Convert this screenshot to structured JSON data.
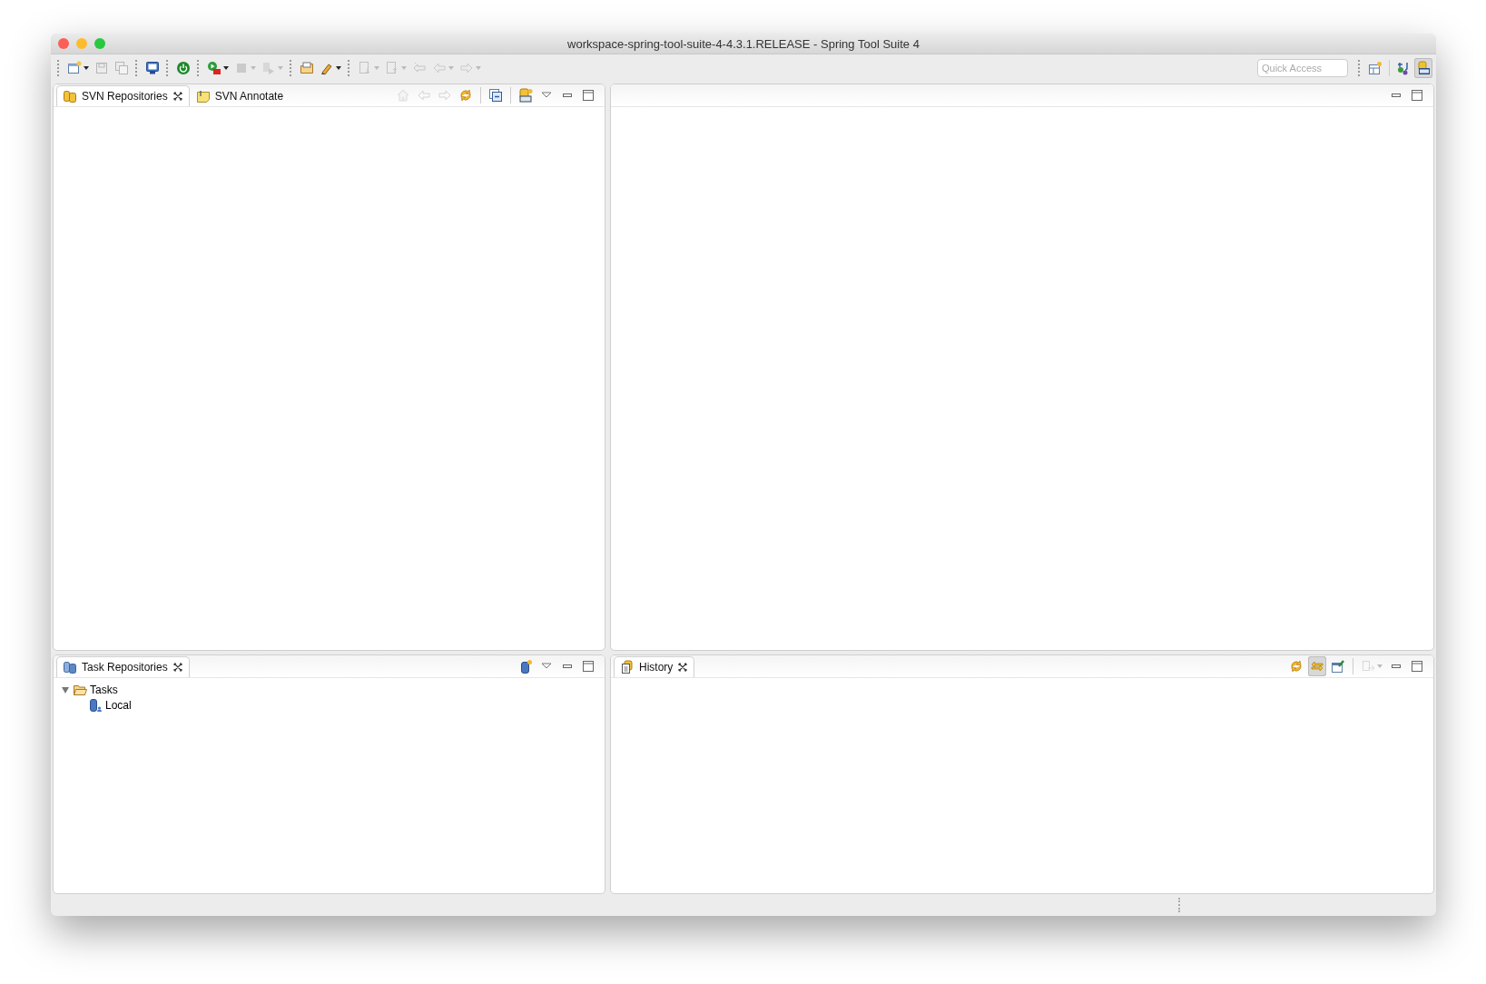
{
  "window": {
    "title": "workspace-spring-tool-suite-4-4.3.1.RELEASE - Spring Tool Suite 4"
  },
  "toolbar": [
    {
      "kind": "new",
      "disabled": false,
      "dropdown": true
    },
    {
      "kind": "save",
      "disabled": true,
      "dropdown": false
    },
    {
      "kind": "save-all",
      "disabled": true,
      "dropdown": false
    },
    {
      "kind": "sep"
    },
    {
      "kind": "console",
      "disabled": false,
      "dropdown": false
    },
    {
      "kind": "sep"
    },
    {
      "kind": "power",
      "disabled": false,
      "dropdown": false
    },
    {
      "kind": "sep"
    },
    {
      "kind": "run",
      "disabled": false,
      "dropdown": true
    },
    {
      "kind": "stop",
      "disabled": true,
      "dropdown": true
    },
    {
      "kind": "step",
      "disabled": true,
      "dropdown": true
    },
    {
      "kind": "sep"
    },
    {
      "kind": "open",
      "disabled": false,
      "dropdown": false
    },
    {
      "kind": "brush",
      "disabled": false,
      "dropdown": true
    },
    {
      "kind": "sep"
    },
    {
      "kind": "next",
      "disabled": true,
      "dropdown": true
    },
    {
      "kind": "prev",
      "disabled": true,
      "dropdown": true
    },
    {
      "kind": "last-edit",
      "disabled": true,
      "dropdown": false
    },
    {
      "kind": "back",
      "disabled": true,
      "dropdown": true
    },
    {
      "kind": "forward",
      "disabled": true,
      "dropdown": true
    }
  ],
  "quick_access": {
    "placeholder": "Quick Access"
  },
  "perspectives": [
    {
      "kind": "open-perspective",
      "selected": false
    },
    {
      "kind": "java",
      "selected": false
    },
    {
      "kind": "svn",
      "selected": true
    }
  ],
  "panels": [
    {
      "tabs": [
        {
          "label": "SVN Repositories",
          "kind": "repo",
          "selected": true,
          "closable": true
        },
        {
          "label": "SVN Annotate",
          "kind": "annotate",
          "selected": false,
          "closable": false
        }
      ],
      "actions": [
        {
          "kind": "home",
          "disabled": true
        },
        {
          "kind": "back",
          "disabled": true
        },
        {
          "kind": "forward",
          "disabled": true
        },
        {
          "kind": "sync",
          "disabled": false
        },
        {
          "kind": "sep"
        },
        {
          "kind": "collapse",
          "disabled": false
        },
        {
          "kind": "sep"
        },
        {
          "kind": "new-repo",
          "disabled": false
        },
        {
          "kind": "menu",
          "disabled": false
        },
        {
          "kind": "minimize",
          "disabled": false
        },
        {
          "kind": "maximize",
          "disabled": false
        }
      ]
    },
    {
      "actions": [
        {
          "kind": "minimize",
          "disabled": false
        },
        {
          "kind": "maximize",
          "disabled": false
        }
      ]
    },
    {
      "tabs": [
        {
          "label": "Task Repositories",
          "kind": "task-repo",
          "selected": true,
          "closable": true
        }
      ],
      "actions": [
        {
          "kind": "add-repo",
          "disabled": false
        },
        {
          "kind": "menu",
          "disabled": false
        },
        {
          "kind": "minimize",
          "disabled": false
        },
        {
          "kind": "maximize",
          "disabled": false
        }
      ],
      "tree": [
        {
          "label": "Tasks",
          "kind": "folder",
          "expanded": true,
          "children": [
            {
              "label": "Local",
              "kind": "local-repo"
            }
          ]
        }
      ]
    },
    {
      "tabs": [
        {
          "label": "History",
          "kind": "history",
          "selected": true,
          "closable": true
        }
      ],
      "actions": [
        {
          "kind": "sync",
          "disabled": false
        },
        {
          "kind": "link",
          "disabled": false,
          "pressed": true
        },
        {
          "kind": "pin",
          "disabled": false
        },
        {
          "kind": "sep"
        },
        {
          "kind": "compare",
          "disabled": true,
          "dropdown": true
        },
        {
          "kind": "minimize",
          "disabled": false
        },
        {
          "kind": "maximize",
          "disabled": false
        }
      ]
    }
  ]
}
